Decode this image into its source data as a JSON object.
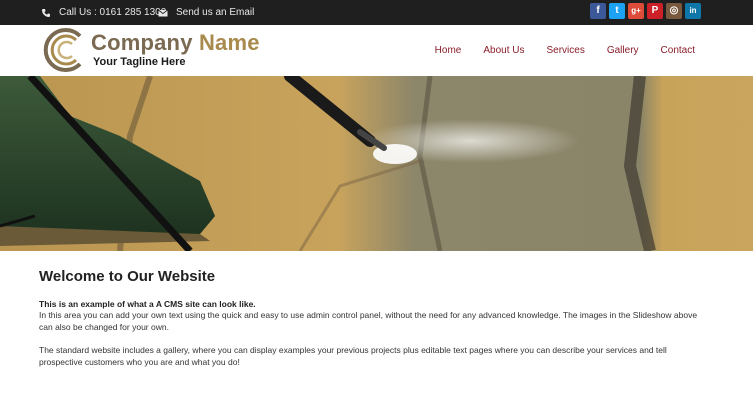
{
  "topbar": {
    "phone": "Call Us : 0161 285 1300",
    "email": "Send us an Email",
    "social": [
      {
        "name": "facebook",
        "glyph": "f",
        "color": "#3b5998"
      },
      {
        "name": "twitter",
        "glyph": "t",
        "color": "#1da1f2"
      },
      {
        "name": "google-plus",
        "glyph": "g+",
        "color": "#dd4b39"
      },
      {
        "name": "pinterest",
        "glyph": "P",
        "color": "#cb2027"
      },
      {
        "name": "instagram",
        "glyph": "◎",
        "color": "#7a5a3e"
      },
      {
        "name": "linkedin",
        "glyph": "in",
        "color": "#0e76a8"
      }
    ]
  },
  "header": {
    "company_name_1": "Company",
    "company_name_2": "Name",
    "tagline": "Your Tagline Here",
    "nav": [
      "Home",
      "About Us",
      "Services",
      "Gallery",
      "Contact"
    ]
  },
  "content": {
    "heading": "Welcome to Our Website",
    "intro": "This is an example of what a A CMS site can look like.",
    "para1": "In this area you can add your own text using the quick and easy to use admin control panel, without the need for any advanced knowledge. The images in the Slideshow above can also be changed for your own.",
    "para2": "The standard website includes a gallery, where you can display examples your previous projects plus editable text pages where you can describe your services and tell prospective customers who you are and what you do!"
  }
}
